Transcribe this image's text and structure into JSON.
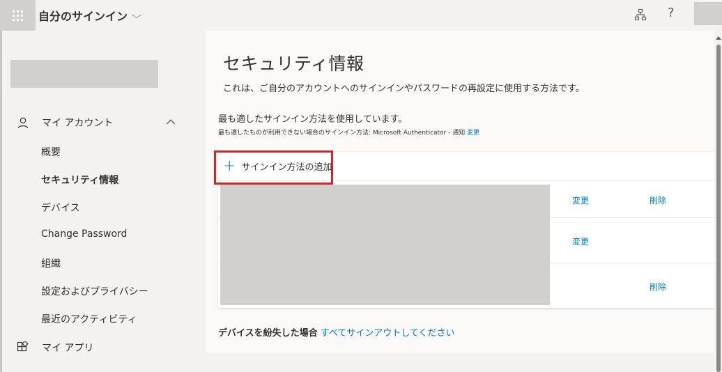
{
  "topbar": {
    "app_title": "自分のサインイン",
    "org_icon": "org-chart-icon",
    "help_label": "?"
  },
  "sidebar": {
    "my_account": "マイ アカウント",
    "items": [
      {
        "label": "概要",
        "active": false
      },
      {
        "label": "セキュリティ情報",
        "active": true
      },
      {
        "label": "デバイス",
        "active": false
      },
      {
        "label": "Change Password",
        "active": false
      },
      {
        "label": "組織",
        "active": false
      },
      {
        "label": "設定およびプライバシー",
        "active": false
      },
      {
        "label": "最近のアクティビティ",
        "active": false
      }
    ],
    "my_apps": "マイ アプリ"
  },
  "main": {
    "title": "セキュリティ情報",
    "subtitle": "これは、ご自分のアカウントへのサインインやパスワードの再設定に使用する方法です。",
    "default_method_heading": "最も適したサインイン方法を使用しています。",
    "default_method_detail": "最も適したものが利用できない場合のサインイン方法: Microsoft Authenticator - 通知",
    "default_method_change": "変更",
    "add_method_label": "サインイン方法の追加",
    "rows": [
      {
        "change": "変更",
        "delete": "削除"
      },
      {
        "change": "変更",
        "delete": ""
      },
      {
        "change": "",
        "delete": "削除"
      }
    ],
    "lost_device_label": "デバイスを紛失した場合",
    "sign_out_all_link": "すべてサインアウトしてください"
  },
  "colors": {
    "accent": "#0078d4",
    "highlight": "#d1252a"
  }
}
